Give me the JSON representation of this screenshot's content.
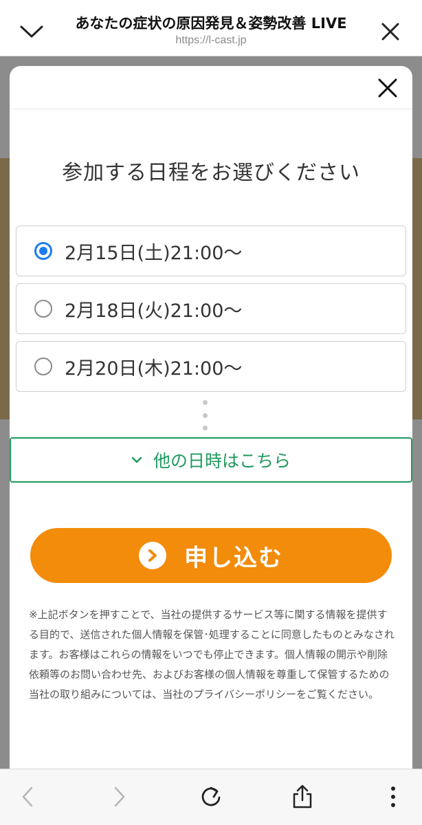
{
  "header": {
    "title": "あなたの症状の原因発見＆姿勢改善 LIVE",
    "url": "https://l-cast.jp"
  },
  "modal": {
    "heading": "参加する日程をお選びください",
    "options": [
      {
        "label": "2月15日(土)21:00～",
        "selected": true
      },
      {
        "label": "2月18日(火)21:00～",
        "selected": false
      },
      {
        "label": "2月20日(木)21:00～",
        "selected": false
      }
    ],
    "more_label": "他の日時はこちら",
    "apply_label": "申し込む",
    "disclaimer": "※上記ボタンを押すことで、当社の提供するサービス等に関する情報を提供する目的で、送信された個人情報を保管･処理することに同意したものとみなされます。お客様はこれらの情報をいつでも停止できます。個人情報の開示や削除依頼等のお問い合わせ先、およびお客様の個人情報を尊重して保管するための当社の取り組みについては、当社のプライバシーポリシーをご覧ください。"
  },
  "colors": {
    "accent_blue": "#1a7df0",
    "green": "#1f9a5e",
    "orange": "#f28c0a"
  },
  "icons": {
    "top_left": "chevron-down-icon",
    "top_right": "close-icon",
    "modal_close": "close-icon",
    "more": "chevron-down-icon",
    "apply": "arrow-right-circle-icon",
    "toolbar": [
      "back-icon",
      "forward-icon",
      "reload-icon",
      "share-icon",
      "more-vertical-icon"
    ]
  }
}
